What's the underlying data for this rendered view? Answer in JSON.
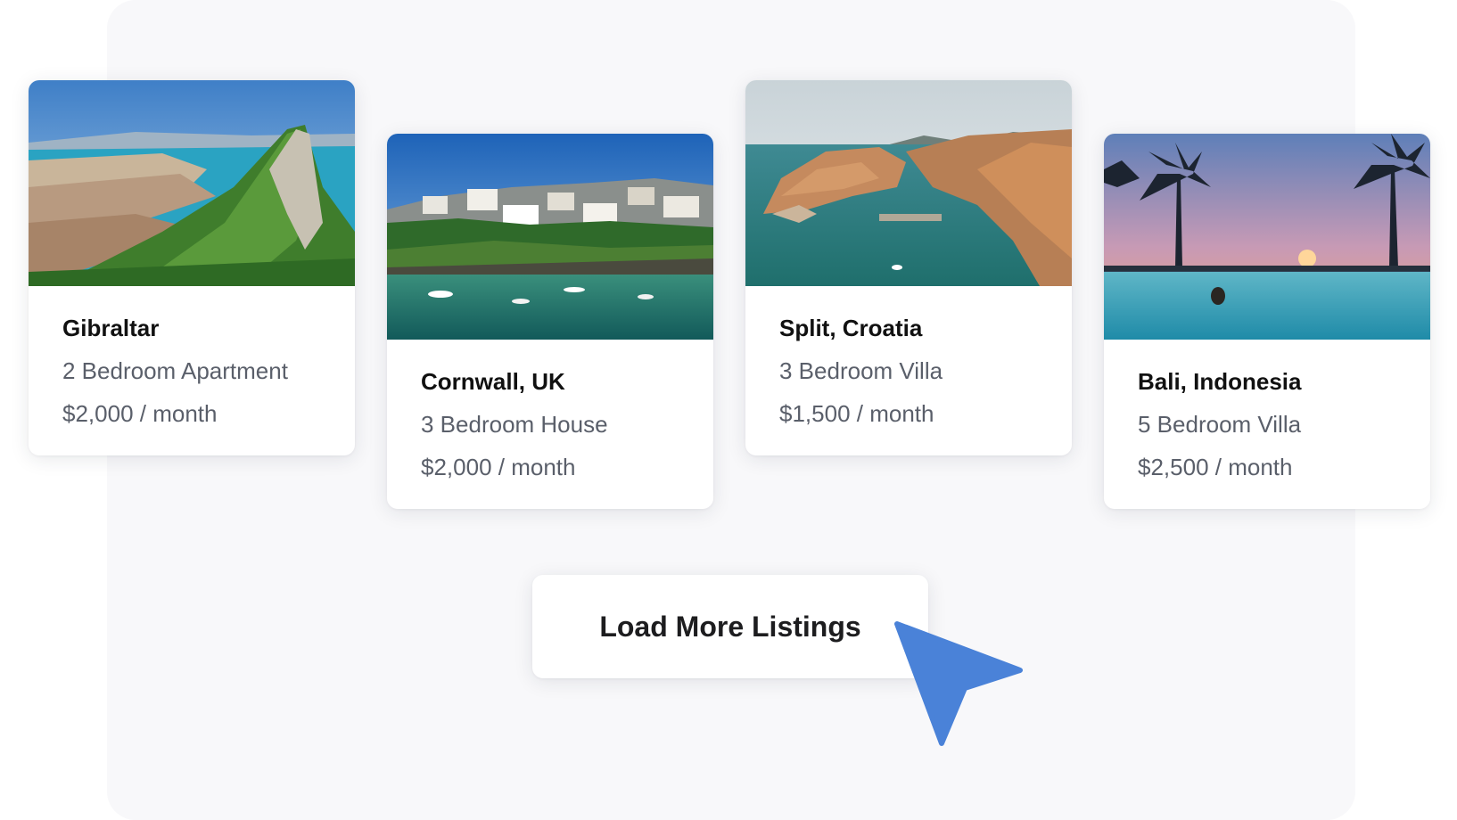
{
  "listings": [
    {
      "title": "Gibraltar",
      "type": "2 Bedroom Apartment",
      "price": "$2,000 / month"
    },
    {
      "title": "Cornwall, UK",
      "type": "3 Bedroom House",
      "price": "$2,000 / month"
    },
    {
      "title": "Split, Croatia",
      "type": "3 Bedroom Villa",
      "price": "$1,500 / month"
    },
    {
      "title": "Bali, Indonesia",
      "type": "5 Bedroom Villa",
      "price": "$2,500 / month"
    }
  ],
  "load_more": {
    "label": "Load More Listings"
  },
  "cursor": {
    "icon": "pointer-arrow-icon",
    "color": "#4a82d8"
  },
  "colors": {
    "panel": "#f8f8fa",
    "card": "#ffffff",
    "title_text": "#111111",
    "meta_text": "#5a5f6a"
  }
}
